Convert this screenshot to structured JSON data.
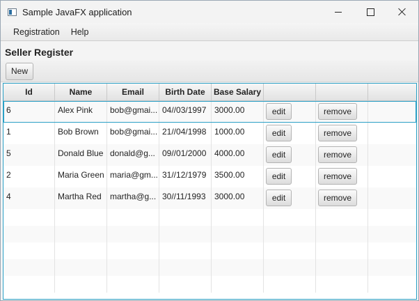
{
  "window": {
    "title": "Sample JavaFX application",
    "icon": "app-window-icon",
    "controls": [
      "minimize-icon",
      "maximize-icon",
      "close-icon"
    ]
  },
  "menu": {
    "items": [
      "Registration",
      "Help"
    ]
  },
  "page": {
    "title": "Seller Register",
    "new_label": "New"
  },
  "table": {
    "columns": [
      "Id",
      "Name",
      "Email",
      "Birth Date",
      "Base Salary",
      "",
      ""
    ],
    "rows": [
      {
        "id": "6",
        "name": "Alex Pink",
        "email": "bob@gmai...",
        "birth_date": "04//03/1997",
        "base_salary": "3000.00",
        "edit": "edit",
        "remove": "remove"
      },
      {
        "id": "1",
        "name": "Bob Brown",
        "email": "bob@gmai...",
        "birth_date": "21//04/1998",
        "base_salary": "1000.00",
        "edit": "edit",
        "remove": "remove"
      },
      {
        "id": "5",
        "name": "Donald Blue",
        "email": "donald@g...",
        "birth_date": "09//01/2000",
        "base_salary": "4000.00",
        "edit": "edit",
        "remove": "remove"
      },
      {
        "id": "2",
        "name": "Maria Green",
        "email": "maria@gm...",
        "birth_date": "31//12/1979",
        "base_salary": "3500.00",
        "edit": "edit",
        "remove": "remove"
      },
      {
        "id": "4",
        "name": "Martha Red",
        "email": "martha@g...",
        "birth_date": "30//11/1993",
        "base_salary": "3000.00",
        "edit": "edit",
        "remove": "remove"
      }
    ],
    "selected_row": 0
  },
  "colors": {
    "focus_accent": "#2aa0c6",
    "window_bg": "#f4f4f4"
  }
}
